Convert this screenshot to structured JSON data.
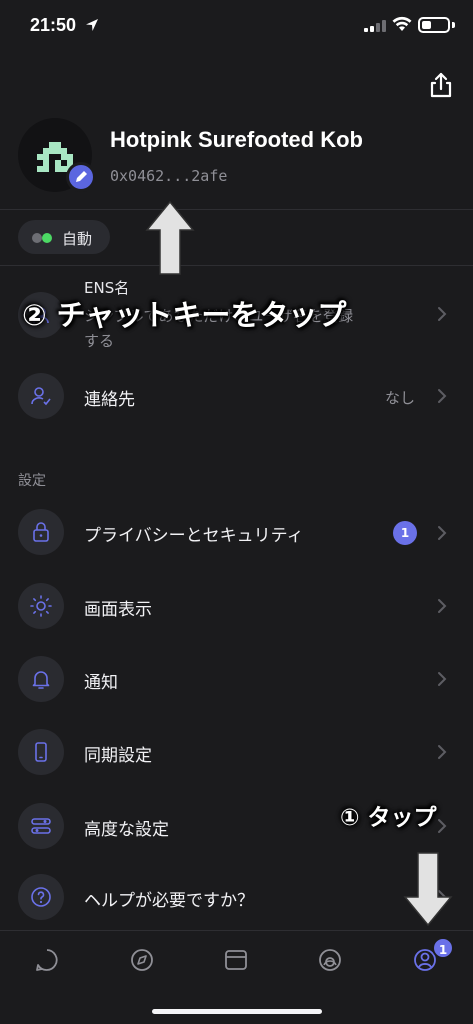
{
  "status_bar": {
    "time": "21:50"
  },
  "profile": {
    "name": "Hotpink Surefooted Kob",
    "address": "0x0462...2afe"
  },
  "mode_chip": {
    "label": "自動"
  },
  "ens": {
    "title": "ENS名",
    "subtitle_line1": "シンプルであなただけのユーザ名を登録",
    "subtitle_line2": "する"
  },
  "contacts": {
    "label": "連絡先",
    "value": "なし"
  },
  "settings_section": {
    "heading": "設定",
    "items": [
      {
        "label": "プライバシーとセキュリティ",
        "badge": "1"
      },
      {
        "label": "画面表示"
      },
      {
        "label": "通知"
      },
      {
        "label": "同期設定"
      },
      {
        "label": "高度な設定"
      },
      {
        "label": "ヘルプが必要ですか？"
      }
    ]
  },
  "annotations": {
    "step2": "② チャットキーをタップ",
    "step1": "① タップ"
  },
  "tab_bar": {
    "profile_badge": "1"
  },
  "colors": {
    "background": "#1b1b1d",
    "accent": "#6a71e8",
    "avatar_pixel": "#a8e6c3",
    "status_green": "#4cd964"
  }
}
